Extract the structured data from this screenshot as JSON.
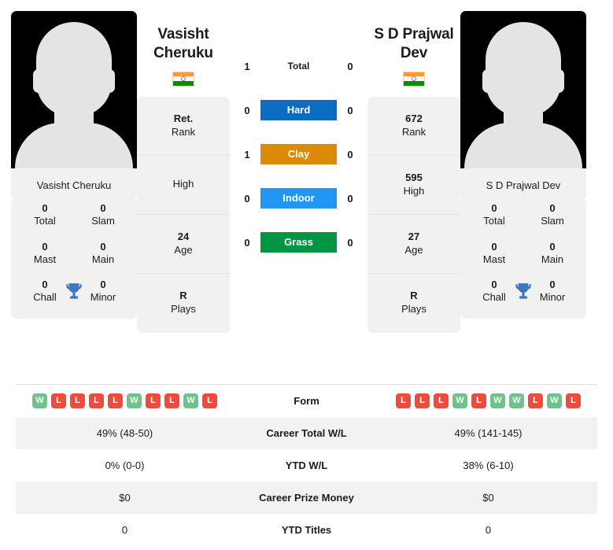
{
  "players": {
    "left": {
      "name": "Vasisht Cheruku",
      "name_display": "Vasisht\nCheruku",
      "name_line1": "Vasisht",
      "name_line2": "Cheruku",
      "country_flag": "india-flag",
      "photo": "player-silhouette-placeholder",
      "titles": [
        {
          "value": "0",
          "label": "Total"
        },
        {
          "value": "0",
          "label": "Slam"
        },
        {
          "value": "0",
          "label": "Mast"
        },
        {
          "value": "0",
          "label": "Main"
        },
        {
          "value": "0",
          "label": "Chall"
        },
        {
          "value": "0",
          "label": "Minor"
        }
      ],
      "info": [
        {
          "value": "Ret.",
          "label": "Rank"
        },
        {
          "value": "",
          "label": "High"
        },
        {
          "value": "24",
          "label": "Age"
        },
        {
          "value": "R",
          "label": "Plays"
        }
      ],
      "h2h": {
        "total": "1",
        "hard": "0",
        "clay": "1",
        "indoor": "0",
        "grass": "0"
      },
      "form": [
        "W",
        "L",
        "L",
        "L",
        "L",
        "W",
        "L",
        "L",
        "W",
        "L"
      ],
      "career_total_wl": "49% (48-50)",
      "ytd_wl": "0% (0-0)",
      "career_prize_money": "$0",
      "ytd_titles": "0"
    },
    "right": {
      "name": "S D Prajwal Dev",
      "name_line1": "S D Prajwal",
      "name_line2": "Dev",
      "country_flag": "india-flag",
      "photo": "player-silhouette-placeholder",
      "titles": [
        {
          "value": "0",
          "label": "Total"
        },
        {
          "value": "0",
          "label": "Slam"
        },
        {
          "value": "0",
          "label": "Mast"
        },
        {
          "value": "0",
          "label": "Main"
        },
        {
          "value": "0",
          "label": "Chall"
        },
        {
          "value": "0",
          "label": "Minor"
        }
      ],
      "info": [
        {
          "value": "672",
          "label": "Rank"
        },
        {
          "value": "595",
          "label": "High"
        },
        {
          "value": "27",
          "label": "Age"
        },
        {
          "value": "R",
          "label": "Plays"
        }
      ],
      "h2h": {
        "total": "0",
        "hard": "0",
        "clay": "0",
        "indoor": "0",
        "grass": "0"
      },
      "form": [
        "L",
        "L",
        "L",
        "W",
        "L",
        "W",
        "W",
        "L",
        "W",
        "L"
      ],
      "career_total_wl": "49% (141-145)",
      "ytd_wl": "38% (6-10)",
      "career_prize_money": "$0",
      "ytd_titles": "0"
    }
  },
  "h2h_labels": {
    "total": "Total",
    "hard": "Hard",
    "clay": "Clay",
    "indoor": "Indoor",
    "grass": "Grass"
  },
  "table_labels": {
    "form": "Form",
    "career_total_wl": "Career Total W/L",
    "ytd_wl": "YTD W/L",
    "career_prize_money": "Career Prize Money",
    "ytd_titles": "YTD Titles"
  },
  "colors": {
    "hard": "#0c6cbf",
    "clay": "#dd8b06",
    "indoor": "#2196f3",
    "grass": "#029542",
    "win_badge": "#6fc38a",
    "loss_badge": "#ef4b3c",
    "card_bg": "#f1f1f1",
    "row_alt_bg": "#f2f2f2",
    "trophy": "#3f76bb"
  }
}
